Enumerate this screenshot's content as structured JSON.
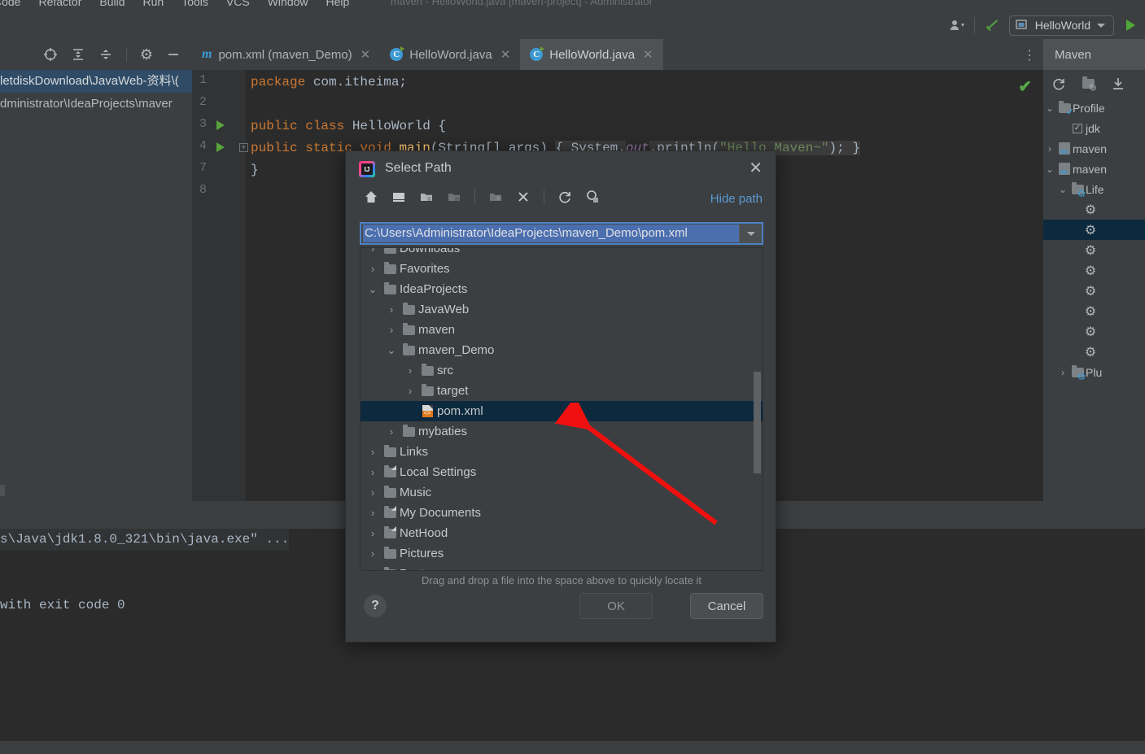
{
  "window": {
    "menu_items": [
      "Code",
      "Refactor",
      "Build",
      "Run",
      "Tools",
      "VCS",
      "Window",
      "Help"
    ],
    "title": "maven - HelloWorld.java [maven-project] - Administrator"
  },
  "toolbar": {
    "run_config_label": "HelloWorld",
    "icons": [
      "user-avatar-icon",
      "build-hammer-icon",
      "run-icon"
    ]
  },
  "project_panel": {
    "toolbar_icons": [
      "locate-icon",
      "expand-all-icon",
      "collapse-all-icon",
      "settings-gear-icon",
      "hide-icon"
    ],
    "recent_paths": [
      "letdiskDownload\\JavaWeb-资料\\(",
      "dministrator\\IdeaProjects\\maver"
    ]
  },
  "editor": {
    "tabs": [
      {
        "label": "pom.xml (maven_Demo)",
        "icon": "maven-m-icon",
        "active": false
      },
      {
        "label": "HelloWord.java",
        "icon": "java-class-icon",
        "active": false
      },
      {
        "label": "HelloWorld.java",
        "icon": "java-class-icon",
        "active": true
      }
    ],
    "lines": [
      {
        "num": "1",
        "run": false,
        "fold": false,
        "tokens": [
          {
            "t": "package ",
            "c": "kw"
          },
          {
            "t": "com.itheima;",
            "c": "pl"
          }
        ]
      },
      {
        "num": "2",
        "run": false,
        "fold": false,
        "tokens": []
      },
      {
        "num": "3",
        "run": true,
        "fold": false,
        "tokens": [
          {
            "t": "public class ",
            "c": "kw"
          },
          {
            "t": "HelloWorld {",
            "c": "pl"
          }
        ]
      },
      {
        "num": "4",
        "run": true,
        "fold": true,
        "tokens": [
          {
            "t": "    public static void ",
            "c": "kw"
          },
          {
            "t": "main",
            "c": "mth"
          },
          {
            "t": "(String[] args) ",
            "c": "pl"
          },
          {
            "t": "{ System.",
            "c": "foldpl"
          },
          {
            "t": "out",
            "c": "fld"
          },
          {
            "t": ".println(",
            "c": "foldpl"
          },
          {
            "t": "\"Hello Maven~\"",
            "c": "str"
          },
          {
            "t": "); }",
            "c": "foldpl"
          }
        ]
      },
      {
        "num": "7",
        "run": false,
        "fold": false,
        "tokens": [
          {
            "t": "}",
            "c": "pl"
          }
        ]
      },
      {
        "num": "8",
        "run": false,
        "fold": false,
        "tokens": []
      }
    ],
    "inspection_status": "✔"
  },
  "console": {
    "lines": [
      {
        "text": "s\\Java\\jdk1.8.0_321\\bin\\java.exe\" ...",
        "highlight": true
      },
      {
        "text": "",
        "highlight": false
      },
      {
        "text": "",
        "highlight": false
      },
      {
        "text": " with exit code 0",
        "highlight": false
      }
    ]
  },
  "maven_panel": {
    "title": "Maven",
    "toolbar_icons": [
      "reload-icon",
      "add-folder-icon",
      "download-icon"
    ],
    "tree": [
      {
        "label": "Profile",
        "icon": "folder-check",
        "chevron": "v",
        "indent": 0,
        "selected": false
      },
      {
        "label": "jdk",
        "icon": "checkbox",
        "chevron": "",
        "indent": 1,
        "selected": false
      },
      {
        "label": "maven",
        "icon": "maven-project",
        "chevron": ">",
        "indent": 0,
        "selected": false
      },
      {
        "label": "maven",
        "icon": "maven-project",
        "chevron": "v",
        "indent": 0,
        "selected": false
      },
      {
        "label": "Life",
        "icon": "folder-gear",
        "chevron": "v",
        "indent": 1,
        "selected": false
      },
      {
        "label": "",
        "icon": "gear",
        "chevron": "",
        "indent": 2,
        "selected": false
      },
      {
        "label": "",
        "icon": "gear",
        "chevron": "",
        "indent": 2,
        "selected": true
      },
      {
        "label": "",
        "icon": "gear",
        "chevron": "",
        "indent": 2,
        "selected": false
      },
      {
        "label": "",
        "icon": "gear",
        "chevron": "",
        "indent": 2,
        "selected": false
      },
      {
        "label": "",
        "icon": "gear",
        "chevron": "",
        "indent": 2,
        "selected": false
      },
      {
        "label": "",
        "icon": "gear",
        "chevron": "",
        "indent": 2,
        "selected": false
      },
      {
        "label": "",
        "icon": "gear",
        "chevron": "",
        "indent": 2,
        "selected": false
      },
      {
        "label": "",
        "icon": "gear",
        "chevron": "",
        "indent": 2,
        "selected": false
      },
      {
        "label": "Plu",
        "icon": "folder-gear",
        "chevron": ">",
        "indent": 1,
        "selected": false
      }
    ]
  },
  "dialog": {
    "title": "Select Path",
    "close_label": "✕",
    "toolbar": {
      "icons": [
        "home-icon",
        "desktop-icon",
        "project-folder-icon",
        "module-folder-icon",
        "new-folder-icon",
        "delete-icon",
        "refresh-icon",
        "show-hidden-icon"
      ],
      "hide_path_label": "Hide path"
    },
    "path_value": "C:\\Users\\Administrator\\IdeaProjects\\maven_Demo\\pom.xml",
    "tree": [
      {
        "label": "Downloads",
        "icon": "folder",
        "chevron": ">",
        "indent": 0,
        "selected": false
      },
      {
        "label": "Favorites",
        "icon": "folder",
        "chevron": ">",
        "indent": 0,
        "selected": false
      },
      {
        "label": "IdeaProjects",
        "icon": "folder",
        "chevron": "v",
        "indent": 0,
        "selected": false
      },
      {
        "label": "JavaWeb",
        "icon": "folder",
        "chevron": ">",
        "indent": 1,
        "selected": false
      },
      {
        "label": "maven",
        "icon": "folder",
        "chevron": ">",
        "indent": 1,
        "selected": false
      },
      {
        "label": "maven_Demo",
        "icon": "folder",
        "chevron": "v",
        "indent": 1,
        "selected": false
      },
      {
        "label": "src",
        "icon": "folder",
        "chevron": ">",
        "indent": 2,
        "selected": false
      },
      {
        "label": "target",
        "icon": "folder",
        "chevron": ">",
        "indent": 2,
        "selected": false
      },
      {
        "label": "pom.xml",
        "icon": "xml-file",
        "chevron": "",
        "indent": 2,
        "selected": true
      },
      {
        "label": "mybaties",
        "icon": "folder",
        "chevron": ">",
        "indent": 1,
        "selected": false
      },
      {
        "label": "Links",
        "icon": "folder",
        "chevron": ">",
        "indent": 0,
        "selected": false
      },
      {
        "label": "Local Settings",
        "icon": "folder-link",
        "chevron": ">",
        "indent": 0,
        "selected": false
      },
      {
        "label": "Music",
        "icon": "folder",
        "chevron": ">",
        "indent": 0,
        "selected": false
      },
      {
        "label": "My Documents",
        "icon": "folder-link",
        "chevron": ">",
        "indent": 0,
        "selected": false
      },
      {
        "label": "NetHood",
        "icon": "folder-link",
        "chevron": ">",
        "indent": 0,
        "selected": false
      },
      {
        "label": "Pictures",
        "icon": "folder",
        "chevron": ">",
        "indent": 0,
        "selected": false
      },
      {
        "label": "Postman",
        "icon": "folder",
        "chevron": ">",
        "indent": 0,
        "selected": false
      }
    ],
    "drag_hint": "Drag and drop a file into the space above to quickly locate it",
    "help_label": "?",
    "ok_label": "OK",
    "cancel_label": "Cancel"
  },
  "annotation": {
    "arrow_color": "#f01010"
  }
}
